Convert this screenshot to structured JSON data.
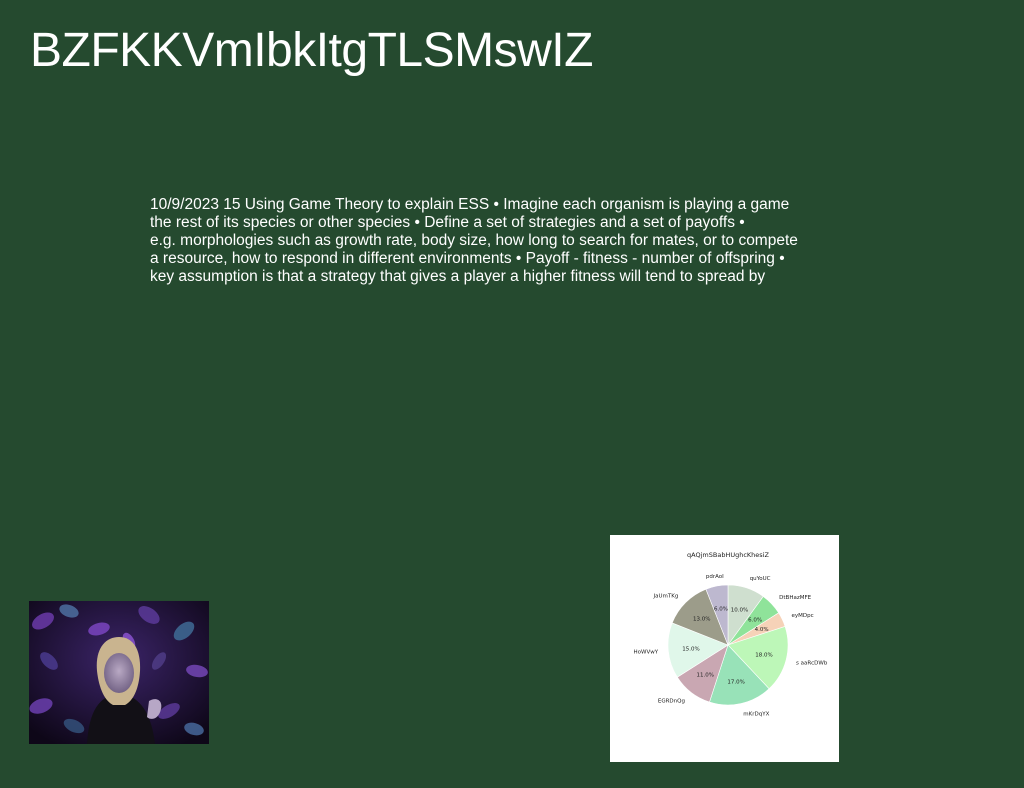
{
  "slide": {
    "title": "BZFKKVmIbkItgTLSMswIZ",
    "body_lines": [
      "10/9/2023 15 Using Game Theory to explain ESS • Imagine each organism is playing a game",
      "the rest of its species or other species • Define a set of strategies and a set of payoffs •",
      "e.g. morphologies such as growth rate, body size, how long to search for mates, or to compete",
      "a resource, how to respond in different environments • Payoff - fitness - number of offspring •",
      "key assumption is that a strategy that gives a player a higher fitness will tend to spread by"
    ]
  },
  "photo": {
    "icon": "portrait-photo",
    "description_colors": [
      "#140a22",
      "#5a2e8c",
      "#2f4a6e"
    ]
  },
  "chart_data": {
    "type": "pie",
    "title": "qAQjmSBabHUghcKhesiZ",
    "start_angle_deg": 90,
    "direction": "clockwise",
    "slices": [
      {
        "label": "quYoUC",
        "value": 10.0,
        "pct_label": "10.0%",
        "color": "#cfdfcf"
      },
      {
        "label": "DtBHazMFE",
        "value": 6.0,
        "pct_label": "6.0%",
        "color": "#8fe39a"
      },
      {
        "label": "eyMDpc",
        "value": 4.0,
        "pct_label": "4.0%",
        "color": "#f6d2b8"
      },
      {
        "label": "s aaRcDWb",
        "value": 18.0,
        "pct_label": "18.0%",
        "color": "#bdf7b8"
      },
      {
        "label": "mKrDqYX",
        "value": 17.0,
        "pct_label": "17.0%",
        "color": "#98e2b8"
      },
      {
        "label": "EGRDnQg",
        "value": 11.0,
        "pct_label": "11.0%",
        "color": "#c9a7b2"
      },
      {
        "label": "HoWVwY",
        "value": 15.0,
        "pct_label": "15.0%",
        "color": "#e0f7ea"
      },
      {
        "label": "JaUmTKg",
        "value": 13.0,
        "pct_label": "13.0%",
        "color": "#9c9c8a"
      },
      {
        "label": "pdrAoI",
        "value": 6.0,
        "pct_label": "6.0%",
        "color": "#bdb8cf"
      }
    ]
  }
}
